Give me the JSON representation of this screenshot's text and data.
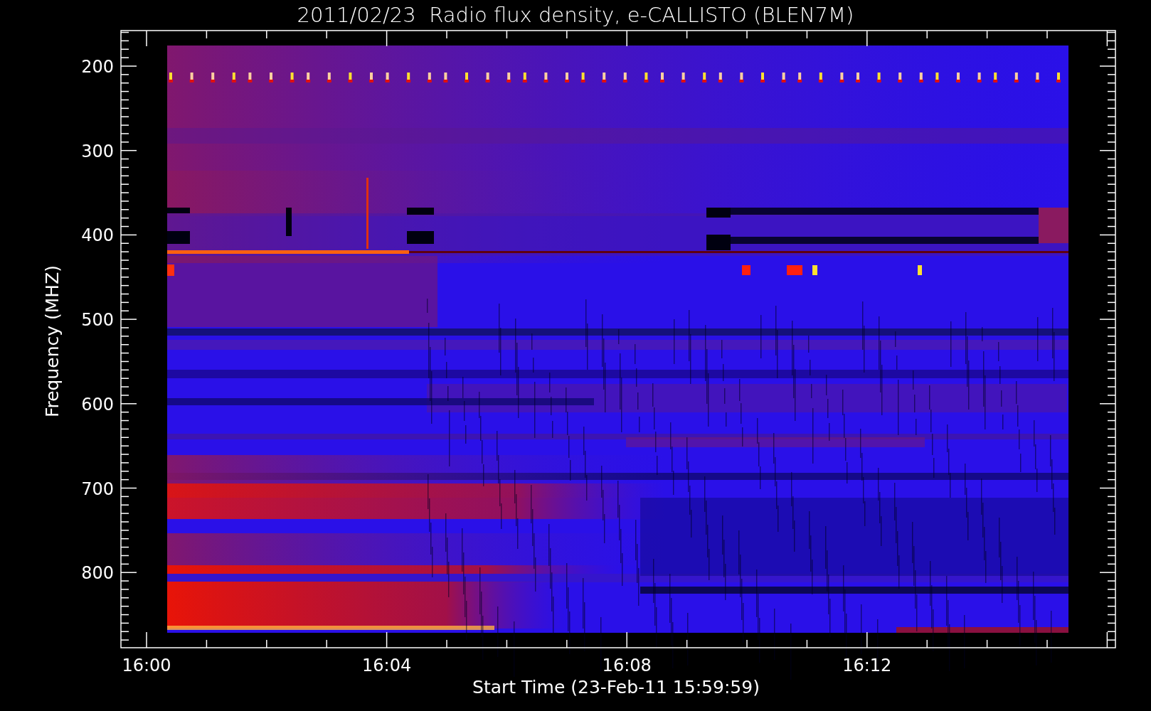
{
  "title": "2011/02/23  Radio flux density, e-CALLISTO (BLEN7M)",
  "plot": {
    "y_axis": {
      "title": "Frequency (MHZ)",
      "ticks": [
        "200",
        "300",
        "400",
        "500",
        "600",
        "700",
        "800"
      ]
    },
    "x_axis": {
      "title": "Start Time (23-Feb-11 15:59:59)",
      "ticks": [
        "16:00",
        "16:04",
        "16:08",
        "16:12"
      ]
    }
  }
}
